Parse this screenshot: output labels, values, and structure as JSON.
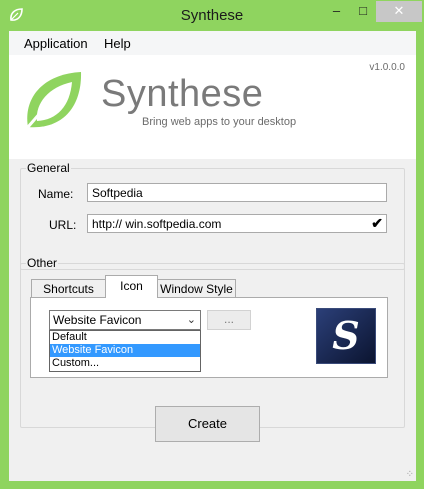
{
  "window": {
    "title": "Synthese",
    "minimize": "–",
    "maximize": "□",
    "close": "✕"
  },
  "menu": {
    "items": [
      "Application",
      "Help"
    ]
  },
  "header": {
    "version": "v1.0.0.0",
    "brand_name": "Synthese",
    "tagline": "Bring web apps to your desktop"
  },
  "general": {
    "legend": "General",
    "name_label": "Name:",
    "name_value": "Softpedia",
    "url_label": "URL:",
    "url_value": "http:// win.softpedia.com",
    "url_valid_icon": "✔"
  },
  "other": {
    "legend": "Other",
    "tabs": [
      "Shortcuts",
      "Icon",
      "Window Style"
    ],
    "active_tab": "Icon",
    "icon_source": {
      "selected": "Website Favicon",
      "options": [
        "Default",
        "Website Favicon",
        "Custom..."
      ]
    },
    "browse_label": "...",
    "preview_letter": "S"
  },
  "actions": {
    "create_label": "Create"
  },
  "colors": {
    "accent": "#8fd45f",
    "selection": "#3399ff",
    "preview_bg": "#0f1b3a"
  }
}
